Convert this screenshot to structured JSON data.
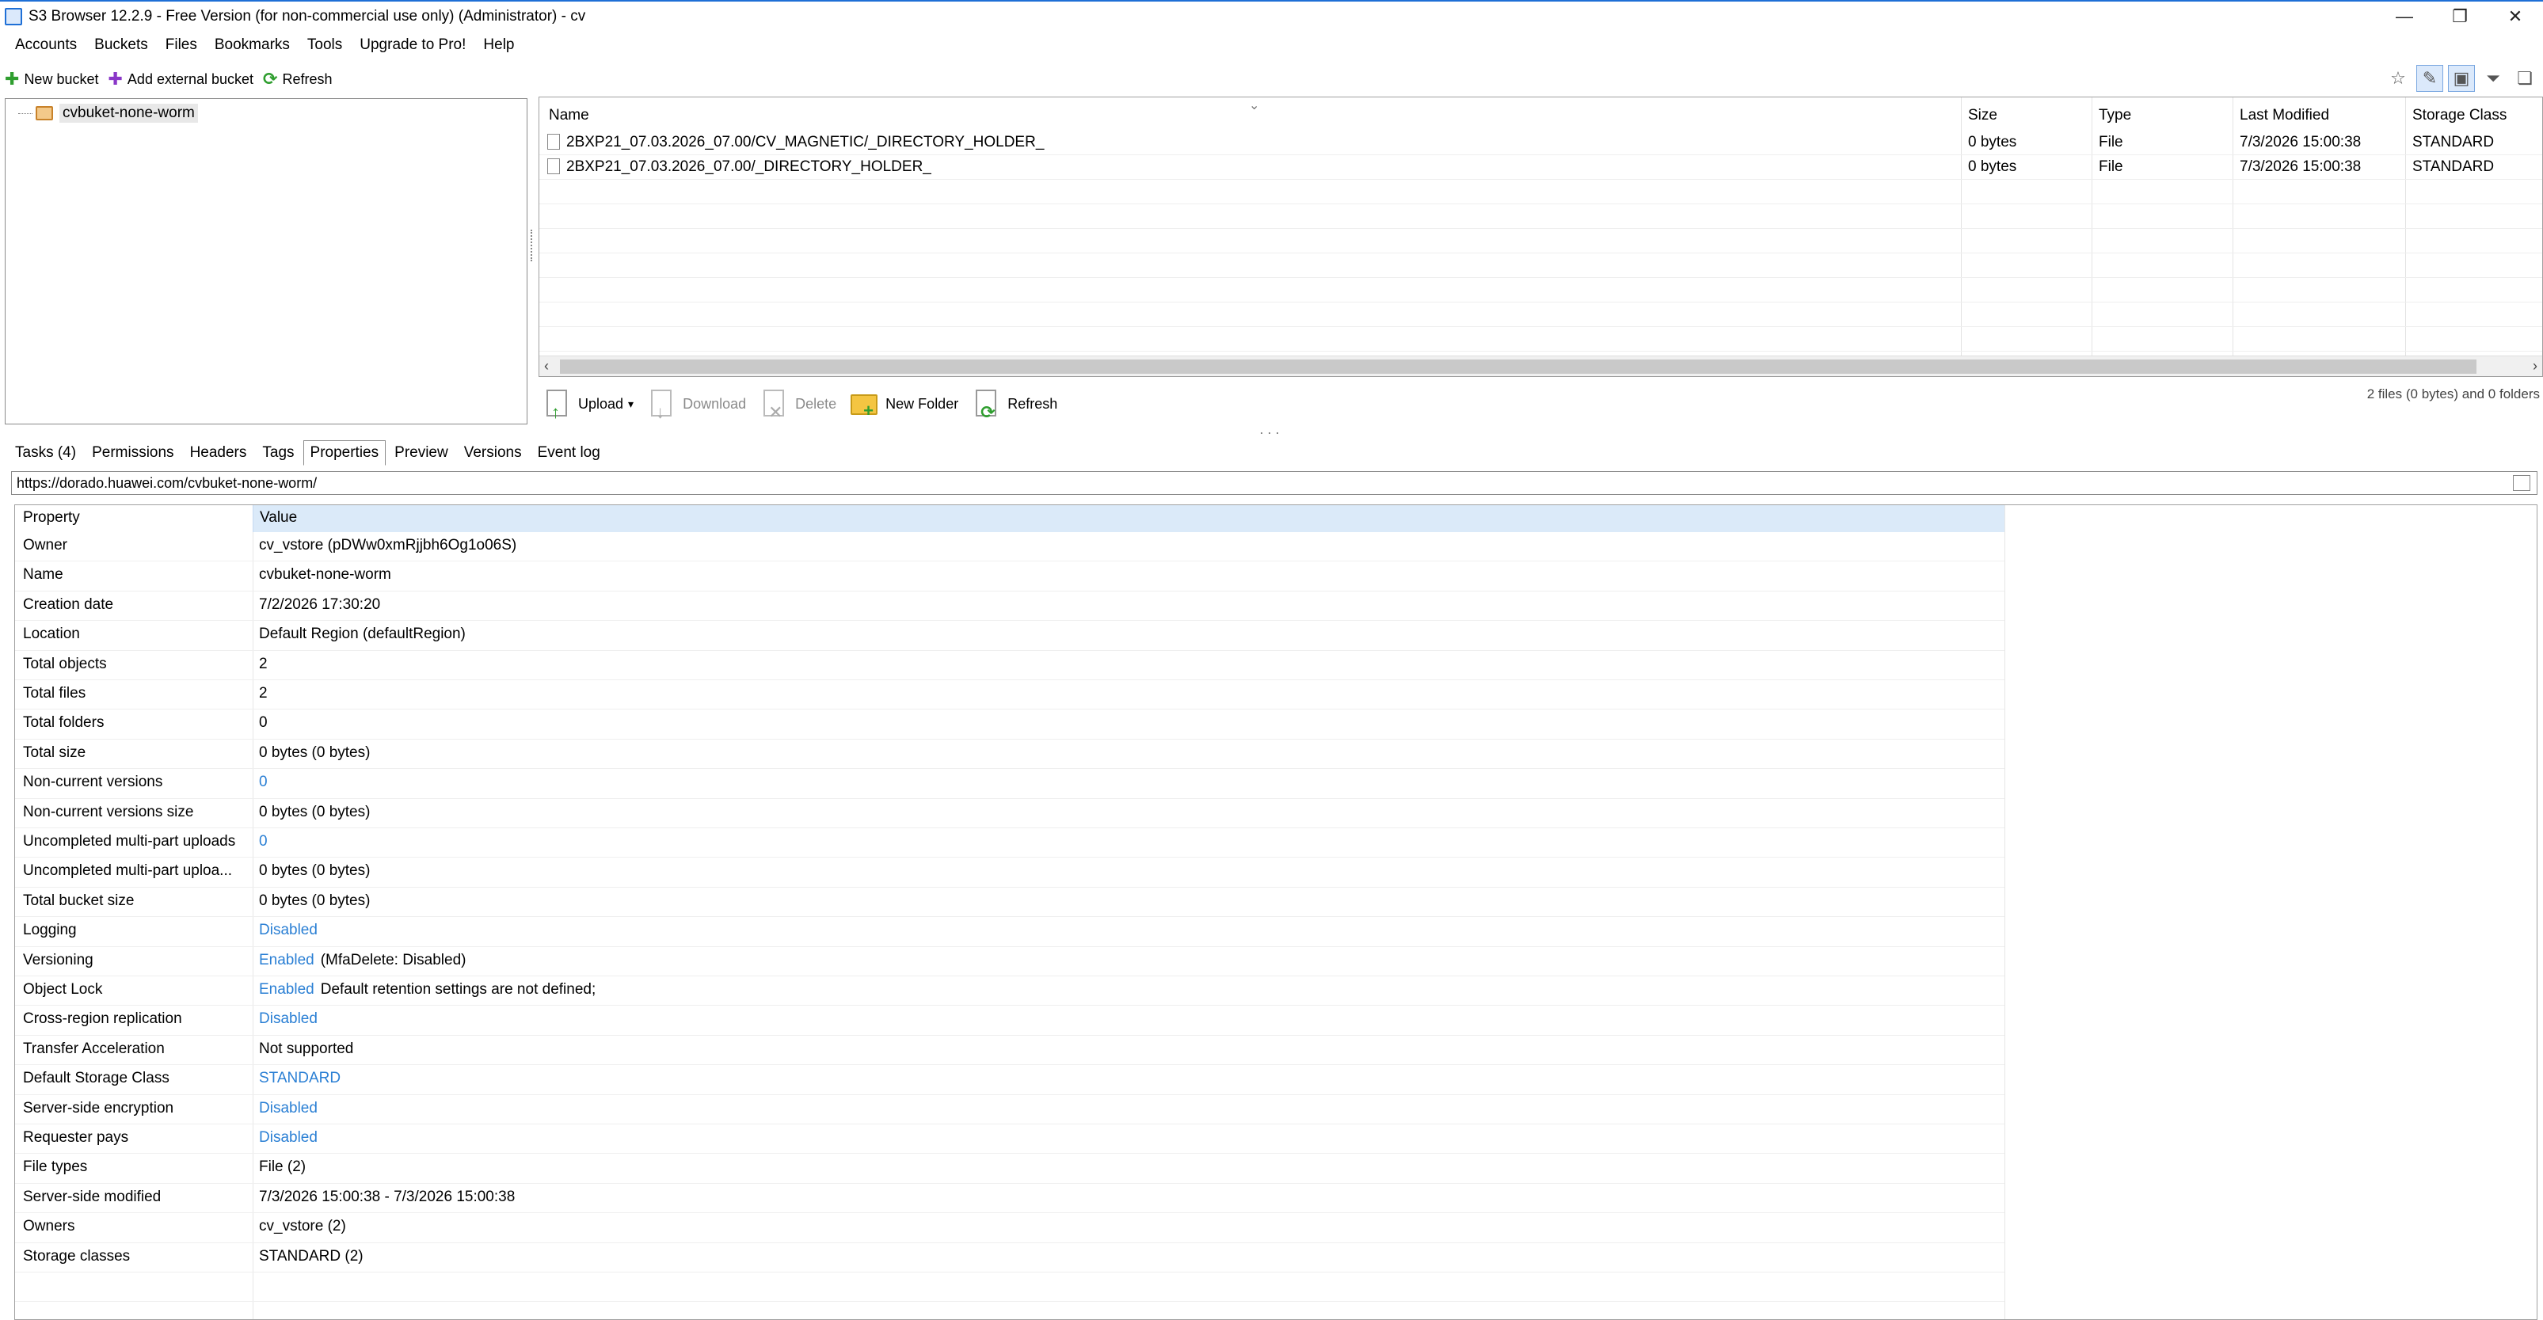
{
  "window": {
    "title": "S3 Browser 12.2.9 - Free Version (for non-commercial use only) (Administrator) - cv",
    "minimize": "—",
    "restore": "❐",
    "close": "✕"
  },
  "menu": [
    "Accounts",
    "Buckets",
    "Files",
    "Bookmarks",
    "Tools",
    "Upgrade to Pro!",
    "Help"
  ],
  "left_toolbar": {
    "new_bucket": "New bucket",
    "add_external_bucket": "Add external bucket",
    "refresh": "Refresh"
  },
  "tree": {
    "bucket": "cvbuket-none-worm"
  },
  "file_list": {
    "columns": [
      "Name",
      "Size",
      "Type",
      "Last Modified",
      "Storage Class"
    ],
    "rows": [
      {
        "name": "2BXP21_07.03.2026_07.00/CV_MAGNETIC/_DIRECTORY_HOLDER_",
        "size": "0 bytes",
        "type": "File",
        "modified": "7/3/2026 15:00:38",
        "storage": "STANDARD"
      },
      {
        "name": "2BXP21_07.03.2026_07.00/_DIRECTORY_HOLDER_",
        "size": "0 bytes",
        "type": "File",
        "modified": "7/3/2026 15:00:38",
        "storage": "STANDARD"
      }
    ]
  },
  "file_toolbar": {
    "upload": "Upload",
    "download": "Download",
    "delete": "Delete",
    "new_folder": "New Folder",
    "refresh": "Refresh"
  },
  "status": "2 files (0 bytes) and 0 folders",
  "tabs": [
    "Tasks (4)",
    "Permissions",
    "Headers",
    "Tags",
    "Properties",
    "Preview",
    "Versions",
    "Event log"
  ],
  "active_tab": "Properties",
  "url": "https://dorado.huawei.com/cvbuket-none-worm/",
  "properties": {
    "header_property": "Property",
    "header_value": "Value",
    "rows": [
      {
        "name": "Owner",
        "value": "cv_vstore (pDWw0xmRjjbh6Og1o06S)"
      },
      {
        "name": "Name",
        "value": "cvbuket-none-worm"
      },
      {
        "name": "Creation date",
        "value": "7/2/2026 17:30:20"
      },
      {
        "name": "Location",
        "value": "Default Region (defaultRegion)"
      },
      {
        "name": "Total objects",
        "value": "2"
      },
      {
        "name": "Total files",
        "value": "2"
      },
      {
        "name": "Total folders",
        "value": "0"
      },
      {
        "name": "Total size",
        "value": "0 bytes (0 bytes)"
      },
      {
        "name": "Non-current versions",
        "link": "0"
      },
      {
        "name": "Non-current versions size",
        "value": "0 bytes (0 bytes)"
      },
      {
        "name": "Uncompleted multi-part uploads",
        "link": "0"
      },
      {
        "name": "Uncompleted multi-part uploa...",
        "value": "0 bytes (0 bytes)"
      },
      {
        "name": "Total bucket size",
        "value": "0 bytes (0 bytes)"
      },
      {
        "name": "Logging",
        "link": "Disabled"
      },
      {
        "name": "Versioning",
        "link": "Enabled",
        "value": "(MfaDelete: Disabled)"
      },
      {
        "name": "Object Lock",
        "link": "Enabled",
        "value": "Default retention settings are not defined;"
      },
      {
        "name": "Cross-region replication",
        "link": "Disabled"
      },
      {
        "name": "Transfer Acceleration",
        "value": "Not supported"
      },
      {
        "name": "Default Storage Class",
        "link": "STANDARD"
      },
      {
        "name": "Server-side encryption",
        "link": "Disabled"
      },
      {
        "name": "Requester pays",
        "link": "Disabled"
      },
      {
        "name": "File types",
        "value": "File (2)"
      },
      {
        "name": "Server-side modified",
        "value": "7/3/2026 15:00:38 - 7/3/2026 15:00:38"
      },
      {
        "name": "Owners",
        "value": "cv_vstore (2)"
      },
      {
        "name": "Storage classes",
        "value": "STANDARD (2)"
      }
    ]
  }
}
